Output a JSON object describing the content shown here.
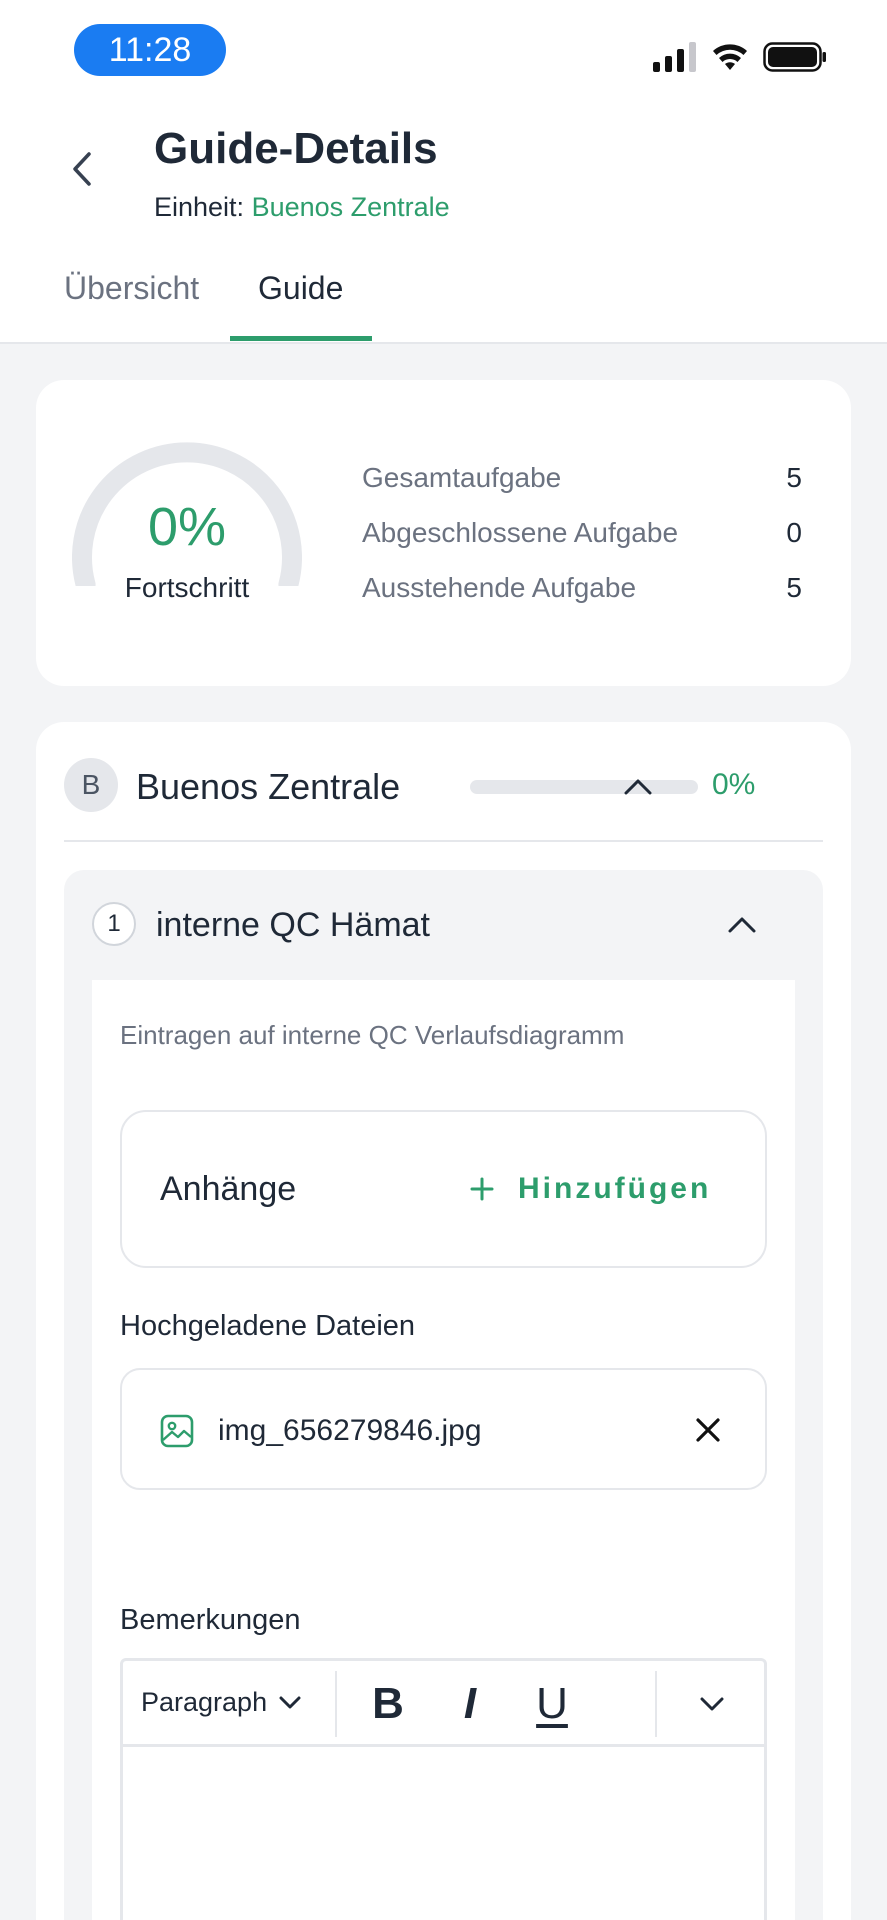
{
  "status_bar": {
    "time": "11:28"
  },
  "header": {
    "title": "Guide-Details",
    "unit_prefix": "Einheit:",
    "unit_name": "Buenos Zentrale",
    "tabs": [
      {
        "label": "Übersicht",
        "active": false
      },
      {
        "label": "Guide",
        "active": true
      }
    ]
  },
  "progress_card": {
    "percent_label": "0%",
    "percent_value": 0,
    "caption": "Fortschritt",
    "stats": [
      {
        "label": "Gesamtaufgabe",
        "value": "5"
      },
      {
        "label": "Abgeschlossene Aufgabe",
        "value": "0"
      },
      {
        "label": "Ausstehende Aufgabe",
        "value": "5"
      }
    ]
  },
  "unit_section": {
    "avatar_letter": "B",
    "name": "Buenos Zentrale",
    "progress_label": "0%",
    "progress_value": 0,
    "step": {
      "number": "1",
      "title": "interne QC Hämat",
      "description": "Eintragen auf interne QC Verlaufsdiagramm",
      "attachments_title": "Anhänge",
      "add_label": "Hinzufügen",
      "uploaded_label": "Hochgeladene Dateien",
      "files": [
        {
          "name": "img_656279846.jpg"
        }
      ],
      "remarks_label": "Bemerkungen",
      "editor": {
        "paragraph_label": "Paragraph",
        "bold": "B",
        "italic": "I",
        "underline": "U"
      }
    }
  },
  "colors": {
    "accent": "#2d9d6c",
    "status_pill": "#1a7cf2",
    "background": "#f3f4f6"
  }
}
